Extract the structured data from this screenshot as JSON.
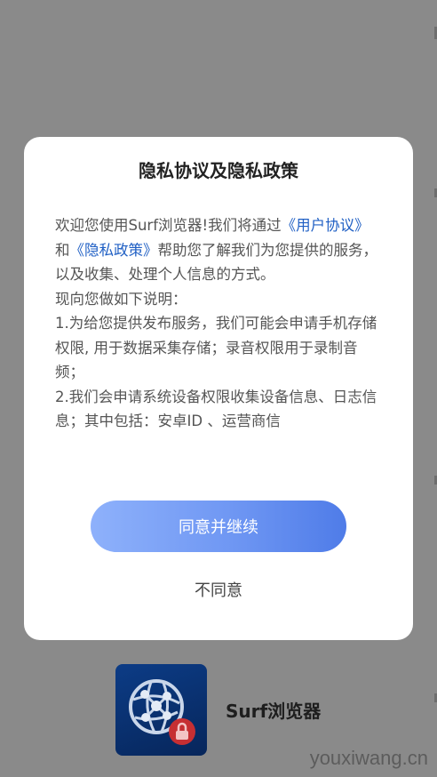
{
  "dialog": {
    "title": "隐私协议及隐私政策",
    "body": {
      "intro_1": "欢迎您使用Surf浏览器!我们将通过",
      "user_agreement_link": "《用户协议》",
      "and": "和",
      "privacy_policy_link": "《隐私政策》",
      "intro_2": "帮助您了解我们为您提供的服务，以及收集、处理个人信息的方式。",
      "explain_heading": "现向您做如下说明：",
      "item_1": "1.为给您提供发布服务，我们可能会申请手机存储权限, 用于数据采集存储；录音权限用于录制音频；",
      "item_2": "2.我们会申请系统设备权限收集设备信息、日志信息；其中包括：安卓ID 、运营商信"
    },
    "agree_label": "同意并继续",
    "disagree_label": "不同意"
  },
  "app": {
    "name": "Surf浏览器",
    "icon": "globe-network-lock-icon",
    "colors": {
      "icon_background": "#0a3274",
      "lock_badge": "#c62f33"
    }
  },
  "watermark": "youxiwang.cn",
  "colors": {
    "overlay": "#8a8a8a",
    "link": "#1f5fc4",
    "button_gradient_start": "#8eb1fb",
    "button_gradient_end": "#4f7ce8"
  }
}
